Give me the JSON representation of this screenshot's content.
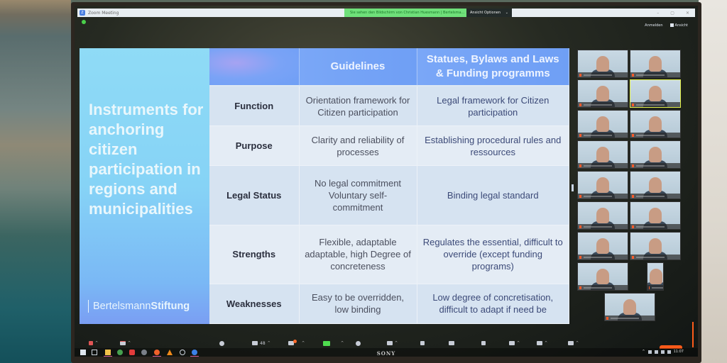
{
  "window": {
    "title": "Zoom Meeting",
    "share_banner": "Sie sehen den Bildschirm von Christian Huesmann | Bertelsma...",
    "view_options": "Ansicht Optionen",
    "top_links": {
      "sign_in": "Anmelden",
      "view": "Ansicht"
    },
    "controls": {
      "minimize": "–",
      "maximize": "▢",
      "close": "✕"
    },
    "monitor_brand": "SONY"
  },
  "slide": {
    "title": "Instruments for anchoring citizen participation in regions and municipalities",
    "brand_regular": "Bertelsmann",
    "brand_bold": "Stiftung",
    "columns": [
      "",
      "Guidelines",
      "Statues, Bylaws and Laws & Funding programms"
    ],
    "rows": [
      {
        "label": "Function",
        "guidelines": "Orientation framework for Citizen participation",
        "statutes": "Legal framework for Citizen participation"
      },
      {
        "label": "Purpose",
        "guidelines": "Clarity and reliability of processes",
        "statutes": "Establishing procedural rules and ressources"
      },
      {
        "label": "Legal Status",
        "guidelines": "No legal commitment Voluntary self-commitment",
        "statutes": "Binding legal standard"
      },
      {
        "label": "Strengths",
        "guidelines": "Flexible, adaptable adaptable, high Degree of concreteness",
        "statutes": "Regulates the essential, difficult to override (except funding programs)"
      },
      {
        "label": "Weaknesses",
        "guidelines": "Easy to be overridden, low binding",
        "statutes": "Low degree of concretisation, difficult to adapt if need be"
      }
    ]
  },
  "gallery": {
    "participant_tiles": 17,
    "active_speaker_index": 3
  },
  "toolbar": {
    "participants_count": "48",
    "chat_badge": "1",
    "icons": [
      "mute-audio-icon",
      "stop-video-icon",
      "security-icon",
      "participants-icon",
      "chat-icon",
      "share-screen-icon",
      "record-icon",
      "captions-icon",
      "polls-icon",
      "breakout-rooms-icon",
      "reactions-icon",
      "apps-icon",
      "whiteboard-icon",
      "more-icon"
    ]
  },
  "taskbar": {
    "apps": [
      "windows-start-icon",
      "task-view-icon",
      "file-explorer-icon",
      "chrome-icon",
      "app-red-icon",
      "app-grey-icon",
      "firefox-icon",
      "vlc-icon",
      "app-circle-icon",
      "zoom-icon"
    ],
    "clock": "11:07"
  },
  "colors": {
    "header_blue": "#6f9ff5",
    "slide_left_blue": "#86d3f6",
    "share_banner_green": "#6fe07a",
    "recording_orange": "#ff5b1a"
  }
}
